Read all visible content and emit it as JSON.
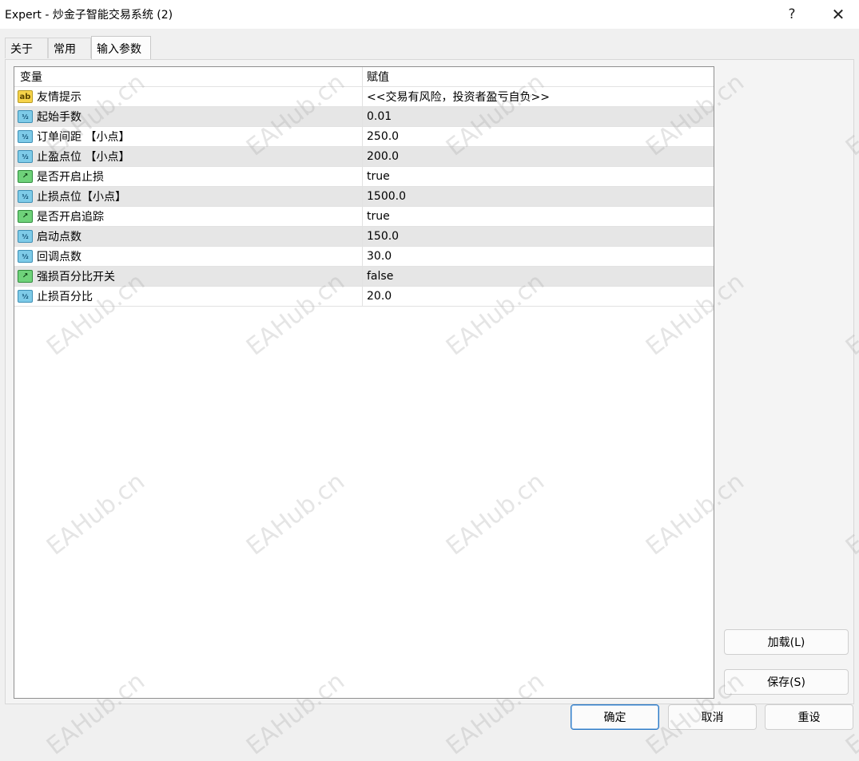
{
  "window": {
    "title": "Expert - 炒金子智能交易系统 (2)",
    "help": "?",
    "close": "✕"
  },
  "tabs": [
    {
      "label": "关于"
    },
    {
      "label": "常用"
    },
    {
      "label": "输入参数",
      "selected": true
    }
  ],
  "table": {
    "headers": {
      "name": "变量",
      "value": "赋值"
    },
    "rows": [
      {
        "icon": "ab",
        "name": "友情提示",
        "value": "<<交易有风险，投资者盈亏自负>>"
      },
      {
        "icon": "½",
        "name": "起始手数",
        "value": "0.01"
      },
      {
        "icon": "½",
        "name": "订单间距 【小点】",
        "value": "250.0"
      },
      {
        "icon": "½",
        "name": "止盈点位 【小点】",
        "value": "200.0"
      },
      {
        "icon": "↗",
        "name": "是否开启止损",
        "value": "true"
      },
      {
        "icon": "½",
        "name": "止损点位【小点】",
        "value": "1500.0"
      },
      {
        "icon": "↗",
        "name": "是否开启追踪",
        "value": "true"
      },
      {
        "icon": "½",
        "name": "启动点数",
        "value": "150.0"
      },
      {
        "icon": "½",
        "name": "回调点数",
        "value": "30.0"
      },
      {
        "icon": "↗",
        "name": "强损百分比开关",
        "value": "false"
      },
      {
        "icon": "½",
        "name": "止损百分比",
        "value": "20.0"
      }
    ]
  },
  "buttons": {
    "load": "加载(L)",
    "save": "保存(S)",
    "ok": "确定",
    "cancel": "取消",
    "reset": "重设"
  },
  "watermark": "EAHub.cn"
}
